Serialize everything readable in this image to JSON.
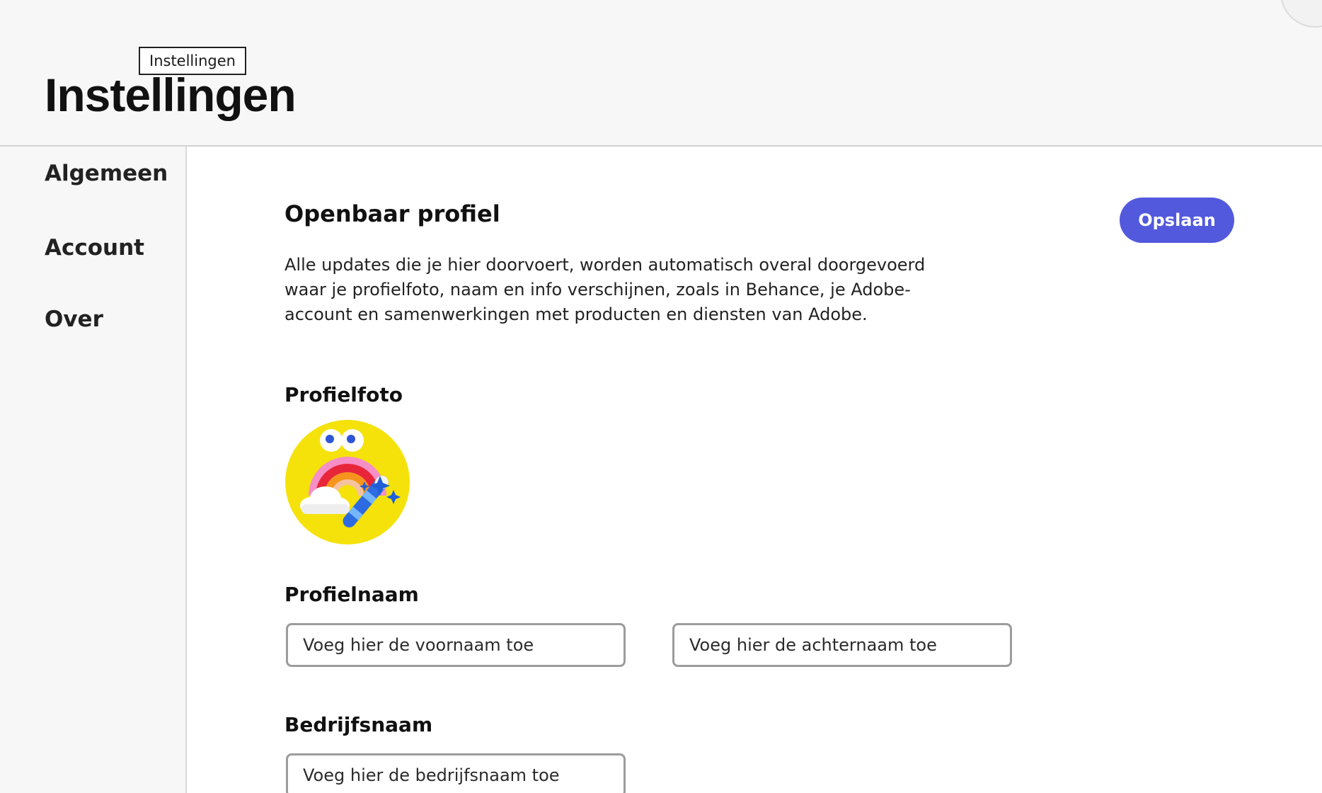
{
  "header": {
    "title": "Instellingen",
    "tooltip": "Instellingen"
  },
  "sidebar": {
    "items": [
      {
        "label": "Algemeen"
      },
      {
        "label": "Account"
      },
      {
        "label": "Over"
      }
    ]
  },
  "main": {
    "section_title": "Openbaar profiel",
    "save_label": "Opslaan",
    "description": "Alle updates die je hier doorvoert, worden automatisch overal doorgevoerd waar je profielfoto, naam en info verschijnen, zoals in Behance, je Adobe-account en samenwerkingen met producten en diensten van Adobe.",
    "profile_photo_label": "Profielfoto",
    "profile_name_label": "Profielnaam",
    "first_name_placeholder": "Voeg hier de voornaam toe",
    "last_name_placeholder": "Voeg hier de achternaam toe",
    "company_label": "Bedrijfsnaam",
    "company_placeholder": "Voeg hier de bedrijfsnaam toe"
  },
  "colors": {
    "accent": "#5259dd",
    "avatar_background": "#f5e20a"
  },
  "icons": {
    "avatar": "rainbow-magic-wand-avatar-icon"
  }
}
